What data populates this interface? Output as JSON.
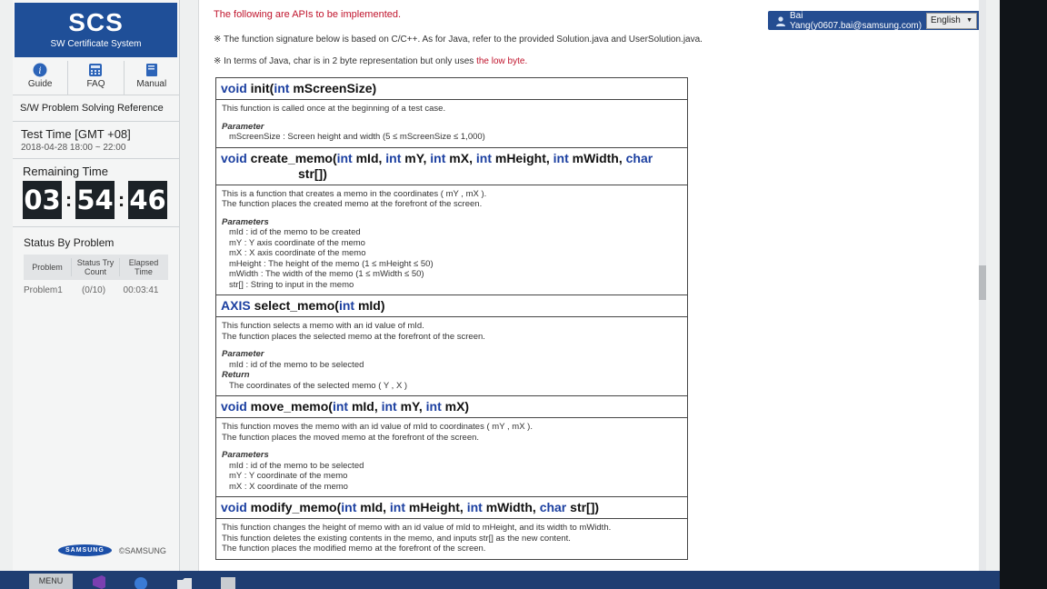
{
  "sidebar": {
    "logo_title": "SCS",
    "logo_subtitle": "SW Certificate System",
    "nav": [
      {
        "label": "Guide",
        "icon": "info-icon"
      },
      {
        "label": "FAQ",
        "icon": "calculator-icon"
      },
      {
        "label": "Manual",
        "icon": "book-icon"
      }
    ],
    "reference_title": "S/W Problem Solving Reference",
    "test_time_label": "Test Time [GMT +08]",
    "test_time_value": "2018-04-28 18:00 ~ 22:00",
    "remaining_label": "Remaining Time",
    "remaining": {
      "hours": "03",
      "minutes": "54",
      "seconds": "46"
    },
    "status_label": "Status By Problem",
    "status_headers": [
      "Problem",
      "Status Try Count",
      "Elapsed Time"
    ],
    "status_rows": [
      {
        "problem": "Problem1",
        "count": "(0/10)",
        "elapsed": "00:03:41"
      }
    ],
    "brand": "SAMSUNG",
    "copyright": "©SAMSUNG"
  },
  "header": {
    "user": "Bai Yang(y0607.bai@samsung.com)",
    "language": "English"
  },
  "notes": {
    "red_note": "The following are APIs to be implemented.",
    "note1": "※ The function signature below is based on C/C++. As for Java, refer to the provided Solution.java and UserSolution.java.",
    "note2_prefix": "※ In terms of Java, char is in 2 byte representation but only uses ",
    "note2_highlight": "the low byte."
  },
  "apis": [
    {
      "ret": "void",
      "name": "init(",
      "params": [
        [
          "int",
          "mScreenSize"
        ]
      ],
      "close": ")",
      "desc": [
        "This function is called once at the beginning of a test case."
      ],
      "param_label": "Parameter",
      "param_lines": [
        "mScreenSize : Screen height and width (5 ≤ mScreenSize ≤ 1,000)"
      ]
    },
    {
      "ret": "void",
      "name": "create_memo(",
      "params": [
        [
          "int",
          "mId,"
        ],
        [
          "int",
          "mY,"
        ],
        [
          "int",
          "mX,"
        ],
        [
          "int",
          "mHeight,"
        ],
        [
          "int",
          "mWidth,"
        ],
        [
          "char",
          "str[])"
        ]
      ],
      "close": "",
      "desc": [
        "This is a function that creates a memo in the coordinates ( mY , mX ).",
        "The function places the created memo at the forefront of the screen."
      ],
      "param_label": "Parameters",
      "param_lines": [
        "mId : id of the memo to be created",
        "mY : Y axis coordinate of the memo",
        "mX : X axis coordinate of the memo",
        "mHeight : The height of the memo (1 ≤ mHeight ≤ 50)",
        "mWidth : The width of the memo (1 ≤ mWidth ≤ 50)",
        "str[] : String to input in the memo"
      ]
    },
    {
      "ret": "AXIS",
      "name": "select_memo(",
      "params": [
        [
          "int",
          "mId)"
        ]
      ],
      "close": "",
      "desc": [
        "This function selects a memo with an id value of mId.",
        "The function places the selected memo at the forefront of the screen."
      ],
      "param_label": "Parameter",
      "param_lines": [
        "mId : id of the memo to be selected"
      ],
      "return_label": "Return",
      "return_lines": [
        "The coordinates of the selected memo ( Y , X )"
      ]
    },
    {
      "ret": "void",
      "name": "move_memo(",
      "params": [
        [
          "int",
          "mId,"
        ],
        [
          "int",
          "mY,"
        ],
        [
          "int",
          "mX)"
        ]
      ],
      "close": "",
      "desc": [
        "This function moves the memo with an id value of mId to coordinates ( mY , mX ).",
        "The function places the moved memo at the forefront of the screen."
      ],
      "param_label": "Parameters",
      "param_lines": [
        "mId : id of the memo to be selected",
        "mY : Y coordinate of the memo",
        "mX : X coordinate of the memo"
      ]
    },
    {
      "ret": "void",
      "name": "modify_memo(",
      "params": [
        [
          "int",
          "mId,"
        ],
        [
          "int",
          "mHeight,"
        ],
        [
          "int",
          "mWidth,"
        ],
        [
          "char",
          "str[])"
        ]
      ],
      "close": "",
      "desc": [
        "This function changes the height of memo with an id value of mId to mHeight, and its width to mWidth.",
        "This function deletes the existing contents in the memo, and inputs str[] as the new content.",
        "The function places the modified memo at the forefront of the screen."
      ]
    }
  ],
  "taskbar": {
    "menu_label": "MENU"
  }
}
